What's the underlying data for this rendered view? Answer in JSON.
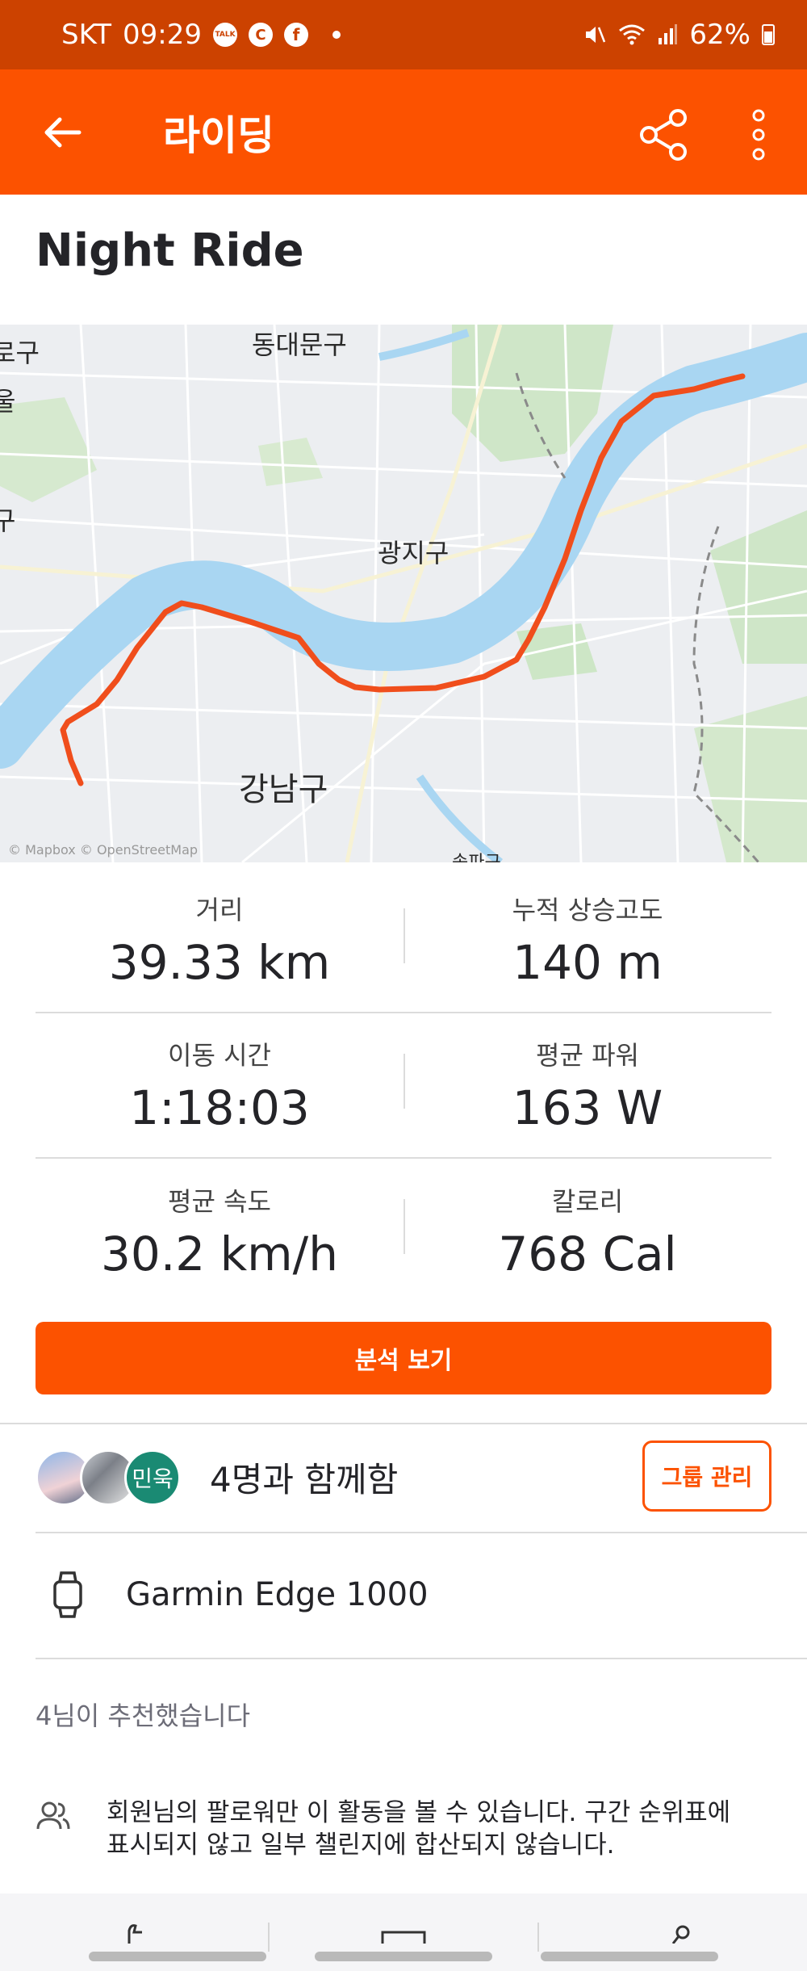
{
  "status_bar": {
    "carrier": "SKT",
    "time": "09:29",
    "notif_icons": [
      "talk-icon",
      "c-icon",
      "facebook-icon"
    ],
    "talk": "TALK",
    "c": "C",
    "fb": "f",
    "battery": "62%"
  },
  "app_bar": {
    "title": "라이딩"
  },
  "activity": {
    "title": "Night Ride"
  },
  "map": {
    "labels": [
      "동대문구",
      "광지구",
      "강남구",
      "로구",
      "울",
      "구",
      "송파구"
    ],
    "attribution": "© Mapbox © OpenStreetMap"
  },
  "stats": [
    {
      "label": "거리",
      "value": "39.33 km"
    },
    {
      "label": "누적 상승고도",
      "value": "140 m"
    },
    {
      "label": "이동 시간",
      "value": "1:18:03"
    },
    {
      "label": "평균 파워",
      "value": "163 W"
    },
    {
      "label": "평균 속도",
      "value": "30.2 km/h"
    },
    {
      "label": "칼로리",
      "value": "768 Cal"
    }
  ],
  "analyze_button": "분석 보기",
  "group": {
    "avatar_initials": "민욱",
    "text": "4명과 함께함",
    "manage_button": "그룹 관리"
  },
  "device": {
    "name": "Garmin Edge 1000"
  },
  "kudos_text": "4님이 추천했습니다",
  "privacy": {
    "line1": "회원님의 팔로워만 이 활동을 볼 수 있습니다. 구간 순위표에",
    "line2": "표시되지 않고 일부 챌린지에 합산되지 않습니다."
  },
  "colors": {
    "brand": "#fc5200",
    "status_bar": "#cc4200",
    "route": "#f04e1c",
    "water": "#a9d6f2"
  }
}
